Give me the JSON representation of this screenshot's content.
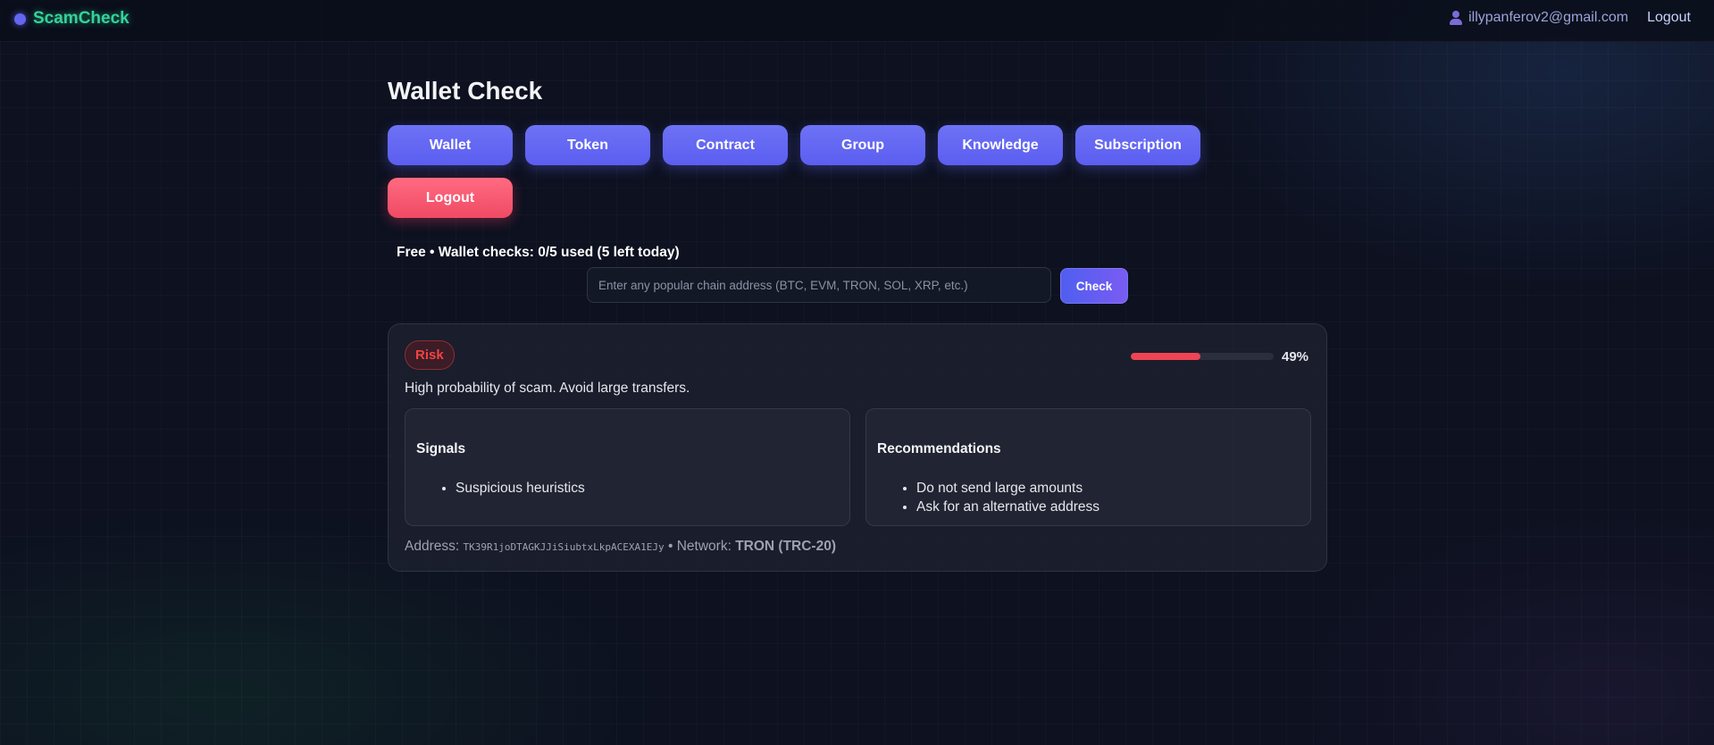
{
  "header": {
    "brand": "ScamCheck",
    "user_email": "illypanferov2@gmail.com",
    "logout_label": "Logout"
  },
  "page": {
    "title": "Wallet Check"
  },
  "nav": {
    "items": [
      {
        "label": "Wallet"
      },
      {
        "label": "Token"
      },
      {
        "label": "Contract"
      },
      {
        "label": "Group"
      },
      {
        "label": "Knowledge"
      },
      {
        "label": "Subscription"
      }
    ],
    "logout_label": "Logout"
  },
  "quota": {
    "text": "Free • Wallet checks: 0/5 used (5 left today)"
  },
  "search": {
    "value": "",
    "placeholder": "Enter any popular chain address (BTC, EVM, TRON, SOL, XRP, etc.)",
    "button_label": "Check"
  },
  "result": {
    "risk_label": "Risk",
    "score_percent": 49,
    "score_text": "49%",
    "verdict": "High probability of scam. Avoid large transfers.",
    "signals": {
      "title": "Signals",
      "items": [
        "Suspicious heuristics"
      ]
    },
    "recommendations": {
      "title": "Recommendations",
      "items": [
        "Do not send large amounts",
        "Ask for an alternative address"
      ]
    },
    "address_label": "Address:",
    "address": "TK39R1joDTAGKJJiSiubtxLkpACEXA1EJy",
    "separator": "•",
    "network_label": "Network:",
    "network": "TRON (TRC-20)"
  },
  "colors": {
    "accent": "#5b5ef0",
    "danger": "#ef4444",
    "brand": "#34d399"
  }
}
